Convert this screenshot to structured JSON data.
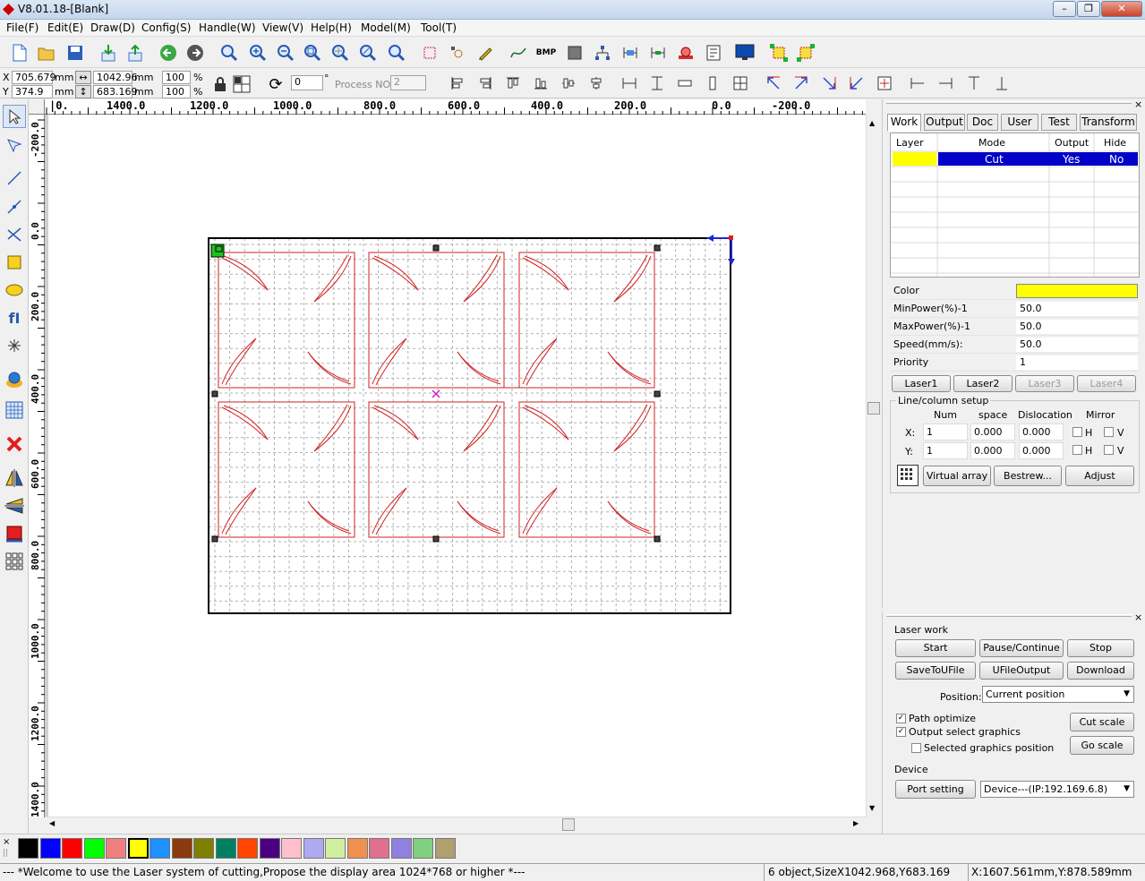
{
  "window": {
    "title": "V8.01.18-[Blank]"
  },
  "menu": [
    "File(F)",
    "Edit(E)",
    "Draw(D)",
    "Config(S)",
    "Handle(W)",
    "View(V)",
    "Help(H)",
    "Model(M)",
    "Tool(T)"
  ],
  "props": {
    "x_label": "X",
    "x_value": "705.679",
    "y_label": "Y",
    "y_value": "374.9",
    "unit": "mm",
    "width_value": "1042.96",
    "height_value": "683.169",
    "scale_x": "100",
    "scale_y": "100",
    "pct": "%",
    "rotate_value": "0",
    "degree": "°",
    "process_no_label": "Process NO:",
    "process_no_value": "2"
  },
  "ruler": {
    "h": [
      "1400.0",
      "1200.0",
      "1000.0",
      "800.0",
      "600.0",
      "400.0",
      "200.0",
      "0.0",
      "-200.0"
    ],
    "v": [
      "-200.0",
      "0.0",
      "200.0",
      "400.0",
      "600.0",
      "800.0",
      "1000.0",
      "1200.0",
      "1400.0"
    ]
  },
  "tabs": [
    "Work",
    "Output",
    "Doc",
    "User",
    "Test",
    "Transform"
  ],
  "layer_table": {
    "headers": [
      "Layer",
      "Mode",
      "Output",
      "Hide"
    ],
    "rows": [
      {
        "color": "#ffff00",
        "mode": "Cut",
        "output": "Yes",
        "hide": "No"
      }
    ]
  },
  "layer_props": [
    {
      "key": "Color",
      "value": ""
    },
    {
      "key": "MinPower(%)-1",
      "value": "50.0"
    },
    {
      "key": "MaxPower(%)-1",
      "value": "50.0"
    },
    {
      "key": "Speed(mm/s):",
      "value": "50.0"
    },
    {
      "key": "Priority",
      "value": "1"
    }
  ],
  "layer_color": "#ffff00",
  "laser_buttons": [
    "Laser1",
    "Laser2",
    "Laser3",
    "Laser4"
  ],
  "array": {
    "title": "Line/column setup",
    "headers": [
      "Num",
      "space",
      "Dislocation",
      "Mirror"
    ],
    "x_label": "X:",
    "y_label": "Y:",
    "x": [
      "1",
      "0.000",
      "0.000"
    ],
    "y": [
      "1",
      "0.000",
      "0.000"
    ],
    "h": "H",
    "v": "V",
    "buttons": [
      "Virtual array",
      "Bestrew...",
      "Adjust"
    ]
  },
  "laser_work": {
    "title": "Laser work",
    "buttons": [
      "Start",
      "Pause/Continue",
      "Stop",
      "SaveToUFile",
      "UFileOutput",
      "Download"
    ],
    "position_label": "Position:",
    "position_value": "Current position",
    "path_optimize": "Path optimize",
    "output_select": "Output select graphics",
    "selected_position": "Selected graphics position",
    "cut_scale": "Cut scale",
    "go_scale": "Go scale",
    "device_title": "Device",
    "port_setting": "Port setting",
    "device_value": "Device---(IP:192.169.6.8)"
  },
  "palette": [
    "#000000",
    "#0000ff",
    "#ff0000",
    "#00ff00",
    "#f08080",
    "#ffff00",
    "#1e90ff",
    "#8b3a0f",
    "#808000",
    "#008060",
    "#ff4500",
    "#4b0082",
    "#ffc0cb",
    "#b0a8f0",
    "#d0f0a0",
    "#f09050",
    "#e07090",
    "#9080e0",
    "#80d080",
    "#b0a070"
  ],
  "status": {
    "message": "--- *Welcome to use the Laser system of cutting,Propose the display area 1024*768 or higher *---",
    "objects": "6 object,SizeX1042.968,Y683.169",
    "coords": "X:1607.561mm,Y:878.589mm"
  }
}
